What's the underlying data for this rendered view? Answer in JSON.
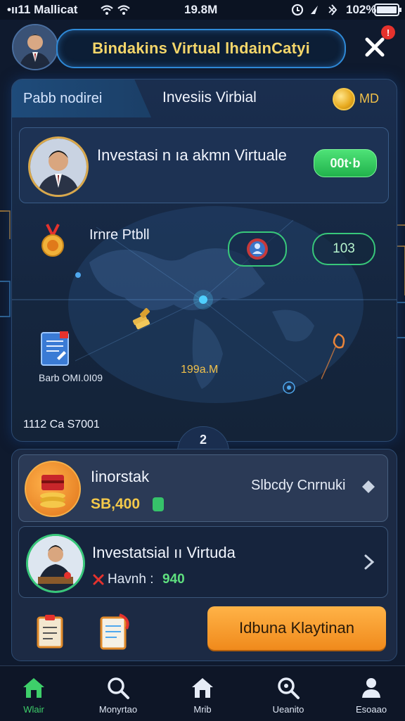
{
  "status_bar": {
    "carrier": "•ıı11 Mallicat",
    "time": "19.8M",
    "battery": "102%"
  },
  "header": {
    "title": "Bindakins Virtual lhdainCatyi",
    "close_badge": "!"
  },
  "main_card": {
    "tab_left": "Pabb nodirei",
    "tab_title": "Invesiis Virbial",
    "coin_label": "MD",
    "panel_name": "Investasi n ıa akmn Virtuale",
    "panel_value": "00t·b",
    "row2_label": "Irnre Ptbll",
    "row2_value": "103",
    "center_value": "199a.M",
    "doc_label": "Barb OMI.0I09",
    "footer_label": "1112 Ca S7001",
    "expand_badge": "2"
  },
  "card_inorstak": {
    "title": "Iinorstak",
    "amount": "SB,400",
    "status": "Slbcdy Cnrnuki"
  },
  "card_investasi": {
    "title": "Investatsial ıı Virtuda",
    "meta_label": "Havnh :",
    "meta_value": "940"
  },
  "action_button": "Idbuna Klaytinan",
  "nav": [
    {
      "label": "Wlair",
      "icon": "home-icon"
    },
    {
      "label": "Monyrtao",
      "icon": "search-icon"
    },
    {
      "label": "Mrib",
      "icon": "home-outline-icon"
    },
    {
      "label": "Ueanito",
      "icon": "search-icon"
    },
    {
      "label": "Esoaao",
      "icon": "user-icon"
    }
  ],
  "colors": {
    "accent_blue": "#2f8ad8",
    "accent_green": "#38c77a",
    "accent_orange": "#f08a1c",
    "title_gold": "#f4d66a"
  }
}
